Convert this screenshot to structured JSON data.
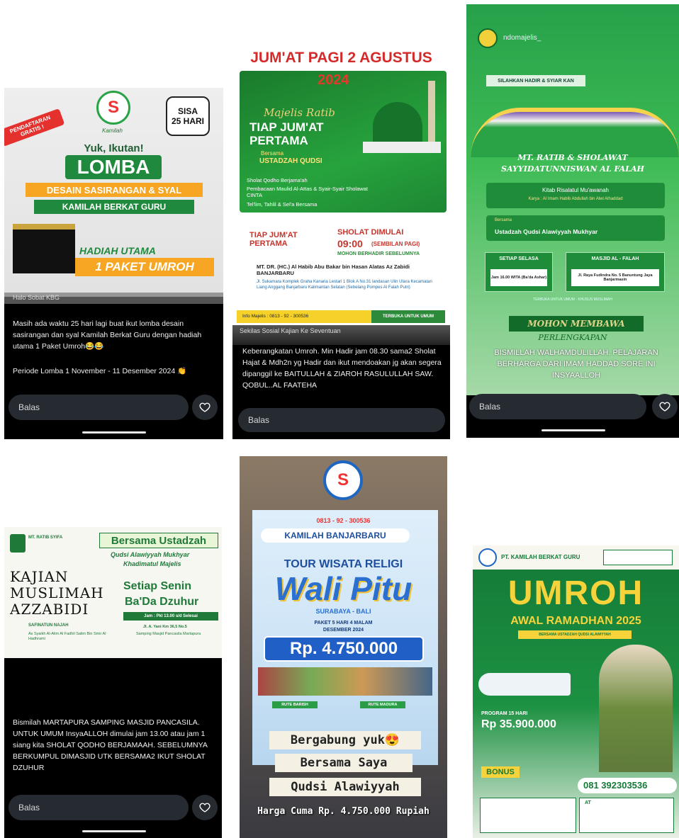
{
  "cards": {
    "c1": {
      "free_ribbon": "PENDAFTARAN GRATIS !",
      "logo_text": "Kamilah",
      "sisa": "SISA",
      "days": "25 HARI",
      "yuk": "Yuk, Ikutan!",
      "lomba": "LOMBA",
      "desain": "DESAIN SASIRANGAN & SYAL",
      "kamilah": "KAMILAH BERKAT GURU",
      "hadiah": "HADIAH UTAMA",
      "paket": "1 PAKET UMROH",
      "user": "Halo Sobat KBG",
      "caption": "Masih ada waktu 25 hari lagi buat ikut lomba desain sasirangan dan syal Kamilah Berkat Guru dengan hadiah utama 1 Paket Umroh😂😂",
      "caption2": "Periode Lomba 1 November - 11 Desember 2024 👏",
      "reply": "Balas"
    },
    "c2": {
      "title": "JUM'AT PAGI 2 AGUSTUS",
      "year": "2024",
      "majelis": "Majelis Ratib",
      "tiap": "TIAP JUM'AT",
      "pertama": "PERTAMA",
      "bersama": "Bersama",
      "ustadzah": "USTADZAH QUDSI",
      "bullets": [
        "Sholat Qodho Berjama'ah",
        "Pembacaan Maulid Al-Attas & Syair-Syair Sholawat CINTA",
        "Tel'lim, Tahlil & Sel'a Bersama"
      ],
      "tiap2": "TIAP JUM'AT PERTAMA",
      "sholat": "SHOLAT DIMULAI",
      "time": "09:00",
      "time_note": "(SEMBILAN PAGI)",
      "mohon": "MOHON BERHADIR SEBELUMNYA",
      "location": "MT. DR. (HC.) Al Habib Abu Bakar bin Hasan Alatas Az Zabidi BANJARBARU",
      "address": "Jl. Sukamara Komplek Graha Kanaria Lestari 1 Blok A No.31 landasan Ulin Utara Kecamatan Liang Anggang Banjarbaru Kalimantan Selatan (Sebelang Pompes Al Falah Putri)",
      "info": "Info Majelis : 0813 - 92 - 300536",
      "terbuka": "TERBUKA UNTUK UMUM",
      "user": "Sekilas Sosial Kajian Ke Seventuan",
      "caption": "Keberangkatan Umroh. Min Hadir jam 08.30 sama2 Sholat Hajat & Mdh2n yg Hadir dan ikut mendoakan jg akan segera dipanggil ke BAITULLAH & ZIAROH RASULULLAH SAW. QOBUL..AL FAATEHA",
      "reply": "Balas"
    },
    "c3": {
      "user": "ndomajelis_",
      "silat": "SILAHKAN HADIR & SYIAR KAN",
      "heading1": "MT. RATIB & SHOLAWAT",
      "heading2": "SAYYIDATUNNISWAN AL FALAH",
      "kitab": "Kitab Risalatul Mu'awanah",
      "karya": "Karya : Al Imam Habib Abdullah bin Alwi Alhaddad",
      "bersama": "Bersama",
      "ustadzah": "Ustadzah Qudsi Alawiyyah Mukhyar",
      "setiap": "SETIAP SELASA",
      "jam": "Jam 16.00 WITA (Ba'da Ashar)",
      "masjid": "MASJID AL - FALAH",
      "alamat": "Jl. Raya Fudindra No. 5 Banuntung Jaya Banjarmasin",
      "terbuka": "TERBUKA UNTUK UMUM - KHUSUS MUSLIMAH",
      "mohon": "MOHON MEMBAWA",
      "perlengkapan": "PERLENGKAPAN",
      "caption": "BISMILLAH WALHAMDULILLAH. PELAJARAN BERHARGA DARI IMAM HADDAD SORE INI INSYAALLOH",
      "reply": "Balas"
    },
    "c4": {
      "org": "MT. RATIB SYIFA",
      "bersama": "Bersama Ustadzah",
      "name": "Qudsi Alawiyyah Mukhyar",
      "title": "Khadimatul Majelis",
      "kajian": "KAJIAN",
      "muslimah": "MUSLIMAH",
      "azzabidi": "AZZABIDI",
      "setiap": "Setiap Senin",
      "bada": "Ba'Da Dzuhur",
      "jam": "Jam : Pkl 13.00 s/d Selesai",
      "kitab": "SAFINATUN NAJAH",
      "pengarang": "As Syaikh Al-Alim Al Fadhil Salim Bin Smir Al Hadhrami",
      "alamat": "Jl. A. Yani Km 36,5 No.5",
      "samping": "Samping Masjid Pancasila Martapura",
      "caption": "Bismilah MARTAPURA SAMPING MASJID PANCASILA. UNTUK UMUM InsyaALLOH dimulai jam 13.00 atau jam 1 siang kita SHOLAT QODHO BERJAMAAH. SEBELUMNYA BERKUMPUL DIMASJID UTK BERSAMA2 IKUT SHOLAT DZUHUR",
      "reply": "Balas"
    },
    "c5": {
      "phone_top": "0813 - 92 - 300536",
      "brand": "KAMILAH BANJARBARU",
      "tour": "TOUR WISATA RELIGI",
      "wali": "Wali Pitu",
      "sub": "SURABAYA - BALI",
      "paket": "PAKET 5 HARI 4 MALAM",
      "date": "DESEMBER 2024",
      "price": "Rp. 4.750.000",
      "rute1": "RUTE BARISH",
      "rute2": "RUTE MADURA",
      "line1": "Bergabung yuk😍",
      "line2": "Bersama Saya",
      "line3": "Qudsi Alawiyyah",
      "harga": "Harga Cuma Rp. 4.750.000 Rupiah"
    },
    "c6": {
      "company": "PT. KAMILAH BERKAT GURU",
      "umroh": "UMROH",
      "awal": "AWAL RAMADHAN 2025",
      "bersama": "BERSAMA USTADZAH QUDSI ALAWIYYAH",
      "program": "PROGRAM 15 HARI",
      "price": "Rp 35.900.000",
      "bonus": "BONUS",
      "phone": "081 392303536",
      "contact": "AT"
    }
  }
}
